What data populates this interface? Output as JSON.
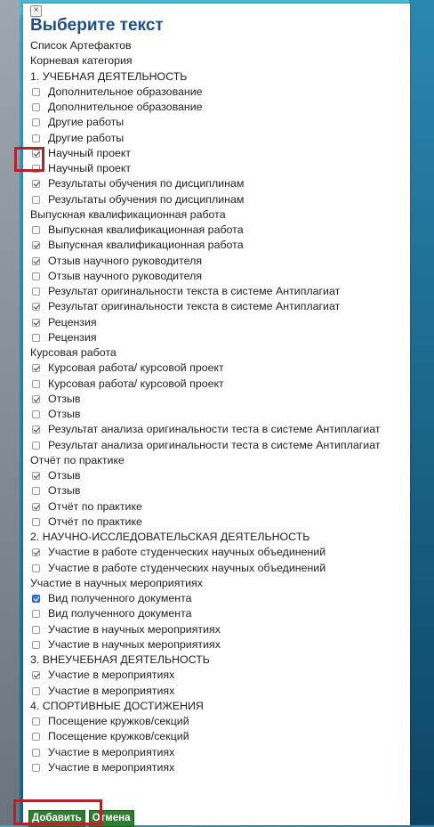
{
  "dialog": {
    "close_glyph": "×",
    "title": "Выберите текст",
    "add_label": "Добавить",
    "cancel_label": "Отмена"
  },
  "rows": [
    {
      "type": "header",
      "text": "Список Артефактов"
    },
    {
      "type": "header",
      "text": "Корневая категория"
    },
    {
      "type": "header",
      "text": "1. УЧЕБНАЯ ДЕЯТЕЛЬНОСТЬ"
    },
    {
      "type": "item",
      "text": "Дополнительное образование",
      "checked": false
    },
    {
      "type": "item",
      "text": "Дополнительное образование",
      "checked": false
    },
    {
      "type": "item",
      "text": "Другие работы",
      "checked": false
    },
    {
      "type": "item",
      "text": "Другие работы",
      "checked": false
    },
    {
      "type": "item",
      "text": "Научный проект",
      "checked": true
    },
    {
      "type": "item",
      "text": "Научный проект",
      "checked": false
    },
    {
      "type": "item",
      "text": "Результаты обучения по дисциплинам",
      "checked": true
    },
    {
      "type": "item",
      "text": "Результаты обучения по дисциплинам",
      "checked": false
    },
    {
      "type": "header",
      "text": "Выпускная квалификационная работа"
    },
    {
      "type": "item",
      "text": "Выпускная квалификационная работа",
      "checked": false
    },
    {
      "type": "item",
      "text": "Выпускная квалификационная работа",
      "checked": true
    },
    {
      "type": "item",
      "text": "Отзыв научного руководителя",
      "checked": true
    },
    {
      "type": "item",
      "text": "Отзыв научного руководителя",
      "checked": false
    },
    {
      "type": "item",
      "text": "Результат оригинальности текста в системе Антиплагиат",
      "checked": false
    },
    {
      "type": "item",
      "text": "Результат оригинальности текста в системе Антиплагиат",
      "checked": true
    },
    {
      "type": "item",
      "text": "Рецензия",
      "checked": true
    },
    {
      "type": "item",
      "text": "Рецензия",
      "checked": false
    },
    {
      "type": "header",
      "text": "Курсовая работа"
    },
    {
      "type": "item",
      "text": "Курсовая работа/ курсовой проект",
      "checked": true
    },
    {
      "type": "item",
      "text": "Курсовая работа/ курсовой проект",
      "checked": false
    },
    {
      "type": "item",
      "text": "Отзыв",
      "checked": true
    },
    {
      "type": "item",
      "text": "Отзыв",
      "checked": false
    },
    {
      "type": "item",
      "text": "Результат анализа оригинальности теста в системе Антиплагиат",
      "checked": true
    },
    {
      "type": "item",
      "text": "Результат анализа оригинальности теста в системе Антиплагиат",
      "checked": false
    },
    {
      "type": "header",
      "text": "Отчёт по практике"
    },
    {
      "type": "item",
      "text": "Отзыв",
      "checked": true
    },
    {
      "type": "item",
      "text": "Отзыв",
      "checked": false
    },
    {
      "type": "item",
      "text": "Отчёт по практике",
      "checked": true
    },
    {
      "type": "item",
      "text": "Отчёт по практике",
      "checked": false
    },
    {
      "type": "header",
      "text": "2. НАУЧНО-ИССЛЕДОВАТЕЛЬСКАЯ ДЕЯТЕЛЬНОСТЬ"
    },
    {
      "type": "item",
      "text": "Участие в работе студенческих научных объединений",
      "checked": true
    },
    {
      "type": "item",
      "text": "Участие в работе студенческих научных объединений",
      "checked": false
    },
    {
      "type": "header",
      "text": "Участие в научных мероприятиях"
    },
    {
      "type": "item",
      "text": "Вид полученного документа",
      "checked": true,
      "blue": true
    },
    {
      "type": "item",
      "text": "Вид полученного документа",
      "checked": false
    },
    {
      "type": "item",
      "text": "Участие в научных мероприятиях",
      "checked": false
    },
    {
      "type": "item",
      "text": "Участие в научных мероприятиях",
      "checked": false
    },
    {
      "type": "header",
      "text": "3. ВНЕУЧЕБНАЯ ДЕЯТЕЛЬНОСТЬ"
    },
    {
      "type": "item",
      "text": "Участие в мероприятиях",
      "checked": true
    },
    {
      "type": "item",
      "text": "Участие в мероприятиях",
      "checked": false
    },
    {
      "type": "header",
      "text": "4. СПОРТИВНЫЕ ДОСТИЖЕНИЯ"
    },
    {
      "type": "item",
      "text": "Посещение кружков/секций",
      "checked": false
    },
    {
      "type": "item",
      "text": "Посещение кружков/секций",
      "checked": false
    },
    {
      "type": "item",
      "text": "Участие в мероприятиях",
      "checked": false
    },
    {
      "type": "item",
      "text": "Участие в мероприятиях",
      "checked": false
    }
  ],
  "colors": {
    "title": "#1f4f84",
    "highlight": "#b0242c",
    "button_bg": "#2e7d32"
  }
}
